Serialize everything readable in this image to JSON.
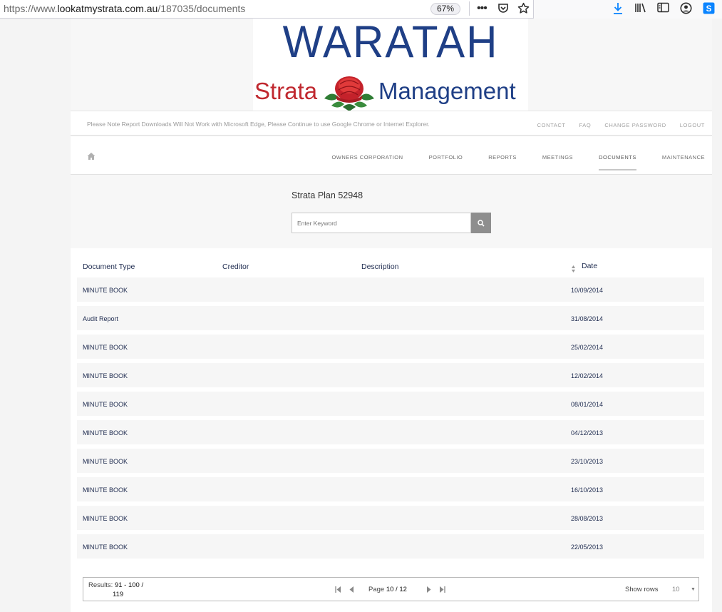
{
  "browser": {
    "url_prefix": "https://www.",
    "url_domain": "lookatmystrata.com.au",
    "url_path": "/187035/documents",
    "zoom": "67%"
  },
  "logo": {
    "line1": "WARATAH",
    "word_strata": "Strata",
    "word_management": "Management",
    "colors": {
      "blue": "#1f3f86",
      "red": "#c0282f"
    }
  },
  "notice": "Please Note Report Downloads Will Not Work with Microsoft Edge, Please Continue to use Google Chrome or Internet Explorer.",
  "top_links": [
    "CONTACT",
    "FAQ",
    "CHANGE PASSWORD",
    "LOGOUT"
  ],
  "nav": {
    "items": [
      {
        "label": "OWNERS CORPORATION"
      },
      {
        "label": "PORTFOLIO"
      },
      {
        "label": "REPORTS"
      },
      {
        "label": "MEETINGS"
      },
      {
        "label": "DOCUMENTS",
        "active": true
      },
      {
        "label": "MAINTENANCE"
      }
    ]
  },
  "plan_title": "Strata Plan 52948",
  "search": {
    "placeholder": "Enter Keyword"
  },
  "table": {
    "headers": [
      "Document Type",
      "Creditor",
      "Description",
      "Date"
    ],
    "rows": [
      {
        "type": "MINUTE BOOK",
        "creditor": "",
        "description": "",
        "date": "10/09/2014"
      },
      {
        "type": "Audit Report",
        "creditor": "",
        "description": "",
        "date": "31/08/2014"
      },
      {
        "type": "MINUTE BOOK",
        "creditor": "",
        "description": "",
        "date": "25/02/2014"
      },
      {
        "type": "MINUTE BOOK",
        "creditor": "",
        "description": "",
        "date": "12/02/2014"
      },
      {
        "type": "MINUTE BOOK",
        "creditor": "",
        "description": "",
        "date": "08/01/2014"
      },
      {
        "type": "MINUTE BOOK",
        "creditor": "",
        "description": "",
        "date": "04/12/2013"
      },
      {
        "type": "MINUTE BOOK",
        "creditor": "",
        "description": "",
        "date": "23/10/2013"
      },
      {
        "type": "MINUTE BOOK",
        "creditor": "",
        "description": "",
        "date": "16/10/2013"
      },
      {
        "type": "MINUTE BOOK",
        "creditor": "",
        "description": "",
        "date": "28/08/2013"
      },
      {
        "type": "MINUTE BOOK",
        "creditor": "",
        "description": "",
        "date": "22/05/2013"
      }
    ]
  },
  "pager": {
    "results_label": "Results:",
    "results_range": "91 - 100 /",
    "results_total": "119",
    "page_label": "Page",
    "page_value": "10 / 12",
    "show_rows_label": "Show rows",
    "rows_value": "10"
  }
}
